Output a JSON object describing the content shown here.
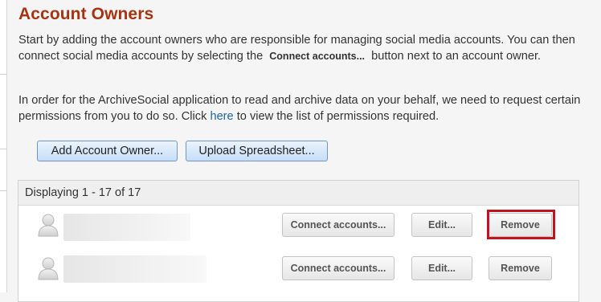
{
  "page": {
    "title": "Account Owners"
  },
  "intro": {
    "text_before": "Start by adding the account owners who are responsible for managing social media accounts. You can then connect social media accounts by selecting the ",
    "inline_button_label": "Connect accounts...",
    "text_after": " button next to an account owner."
  },
  "permissions": {
    "text_before": "In order for the ArchiveSocial application to read and archive data on your behalf, we need to request certain permissions from you to do so. Click ",
    "link_label": "here",
    "text_after": " to view the list of permissions required."
  },
  "actions": {
    "add_owner_label": "Add Account Owner...",
    "upload_label": "Upload Spreadsheet..."
  },
  "list": {
    "summary": "Displaying 1 - 17 of 17",
    "rows": [
      {
        "name": "",
        "connect_label": "Connect accounts...",
        "edit_label": "Edit...",
        "remove_label": "Remove",
        "highlighted": true
      },
      {
        "name": "",
        "connect_label": "Connect accounts...",
        "edit_label": "Edit...",
        "remove_label": "Remove",
        "highlighted": false
      }
    ]
  },
  "colors": {
    "title": "#a8340f",
    "link": "#1a66b3",
    "highlight": "#c1141e",
    "primary_button_border": "#6e97c8"
  },
  "icons": {
    "avatar": "user-silhouette-icon"
  }
}
